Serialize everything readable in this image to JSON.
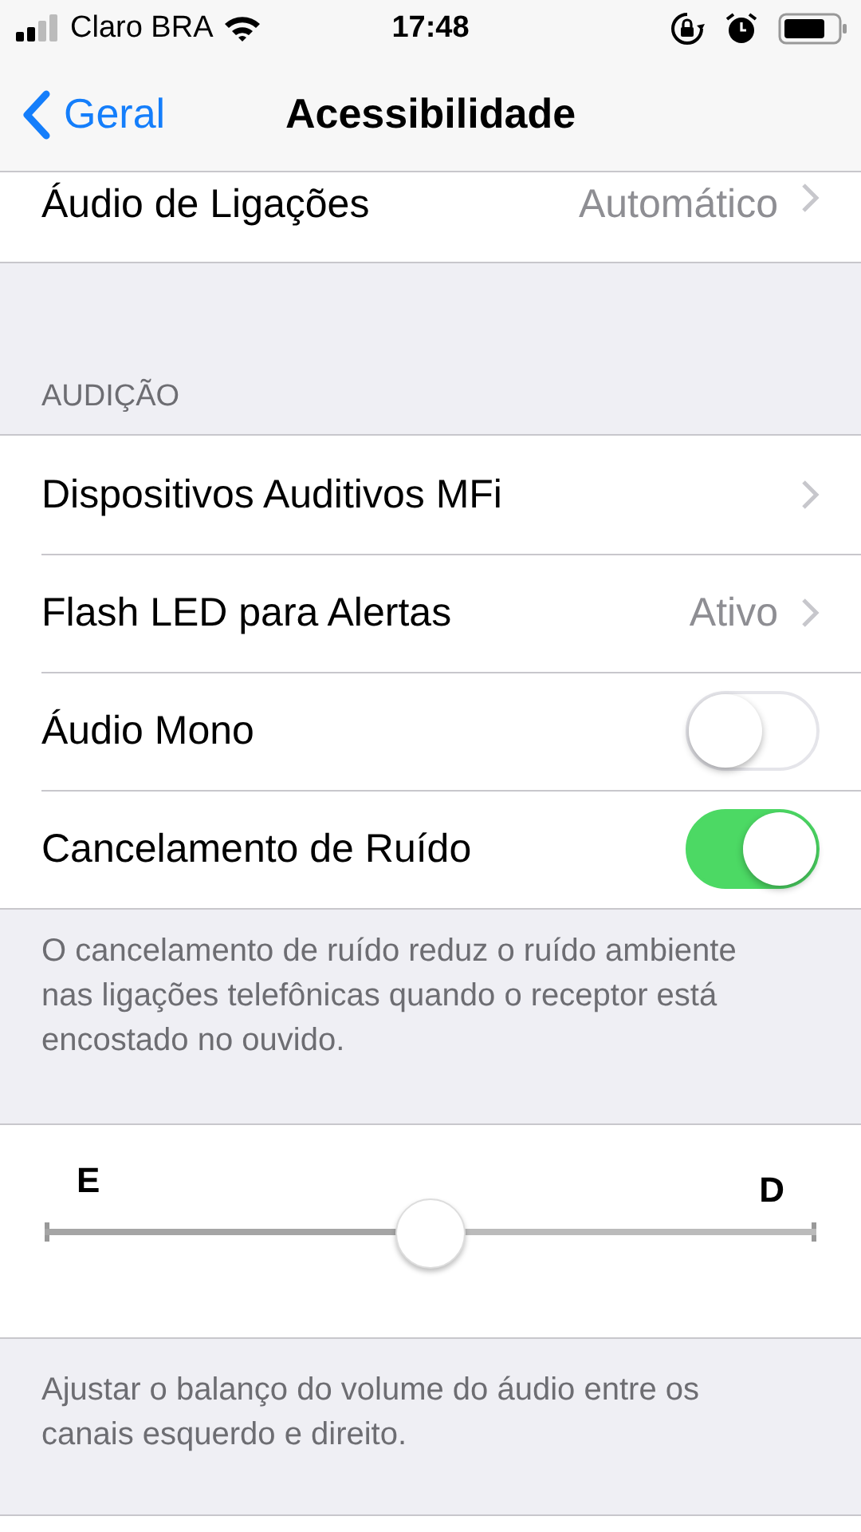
{
  "status_bar": {
    "carrier": "Claro BRA",
    "time": "17:48"
  },
  "nav": {
    "back": "Geral",
    "title": "Acessibilidade"
  },
  "top_rows": [
    {
      "kind": "disclosure",
      "label": "Áudio de Ligações",
      "value": "Automático"
    }
  ],
  "section": {
    "header": "AUDIÇÃO",
    "rows": [
      {
        "kind": "disclosure",
        "label": "Dispositivos Auditivos MFi"
      },
      {
        "kind": "disclosure",
        "label": "Flash LED para Alertas",
        "value": "Ativo"
      },
      {
        "kind": "toggle",
        "label": "Áudio Mono",
        "on": false
      },
      {
        "kind": "toggle",
        "label": "Cancelamento de Ruído",
        "on": true
      }
    ],
    "footer": "O cancelamento de ruído reduz o ruído ambiente nas ligações telefônicas quando o receptor está encostado no ouvido."
  },
  "balance": {
    "left_label": "E",
    "right_label": "D",
    "level": 0.5,
    "footer": "Ajustar o balanço do volume do áudio entre os canais esquerdo e direito."
  }
}
